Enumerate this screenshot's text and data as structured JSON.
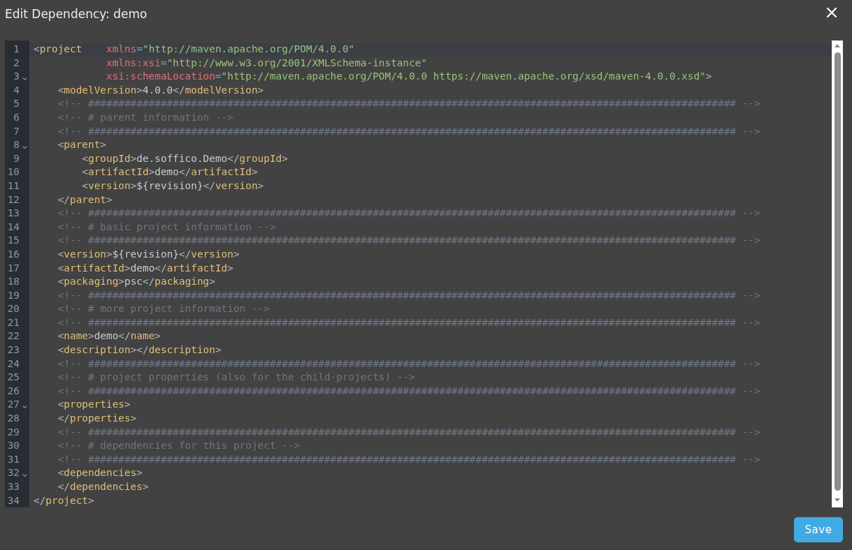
{
  "dialog": {
    "title": "Edit Dependency: demo"
  },
  "editor": {
    "lines": [
      {
        "number": "1",
        "current": true,
        "foldable": false,
        "tokens": [
          {
            "kind": "punct",
            "text": "<"
          },
          {
            "kind": "tag",
            "text": "project"
          },
          {
            "kind": "attr",
            "text": "    xmlns"
          },
          {
            "kind": "eq",
            "text": "="
          },
          {
            "kind": "value",
            "text": "\"http://maven.apache.org/POM/4.0.0\""
          }
        ]
      },
      {
        "number": "2",
        "current": false,
        "foldable": false,
        "tokens": [
          {
            "kind": "attr",
            "text": "            xmlns:xsi"
          },
          {
            "kind": "eq",
            "text": "="
          },
          {
            "kind": "value",
            "text": "\"http://www.w3.org/2001/XMLSchema-instance\""
          }
        ]
      },
      {
        "number": "3",
        "current": false,
        "foldable": true,
        "tokens": [
          {
            "kind": "attr",
            "text": "            xsi:schemaLocation"
          },
          {
            "kind": "eq",
            "text": "="
          },
          {
            "kind": "value",
            "text": "\"http://maven.apache.org/POM/4.0.0 https://maven.apache.org/xsd/maven-4.0.0.xsd\""
          },
          {
            "kind": "punct",
            "text": ">"
          }
        ]
      },
      {
        "number": "4",
        "current": false,
        "foldable": false,
        "tokens": [
          {
            "kind": "punct",
            "text": "    <"
          },
          {
            "kind": "tag",
            "text": "modelVersion"
          },
          {
            "kind": "punct",
            "text": ">"
          },
          {
            "kind": "text",
            "text": "4.0.0"
          },
          {
            "kind": "punct",
            "text": "</"
          },
          {
            "kind": "tag",
            "text": "modelVersion"
          },
          {
            "kind": "punct",
            "text": ">"
          }
        ]
      },
      {
        "number": "5",
        "current": false,
        "foldable": false,
        "tokens": [
          {
            "kind": "comment",
            "text": "    <!-- ########################################################################################################### -->"
          }
        ]
      },
      {
        "number": "6",
        "current": false,
        "foldable": false,
        "tokens": [
          {
            "kind": "comment",
            "text": "    <!-- # parent information -->"
          }
        ]
      },
      {
        "number": "7",
        "current": false,
        "foldable": false,
        "tokens": [
          {
            "kind": "comment",
            "text": "    <!-- ########################################################################################################### -->"
          }
        ]
      },
      {
        "number": "8",
        "current": false,
        "foldable": true,
        "tokens": [
          {
            "kind": "punct",
            "text": "    <"
          },
          {
            "kind": "tag",
            "text": "parent"
          },
          {
            "kind": "punct",
            "text": ">"
          }
        ]
      },
      {
        "number": "9",
        "current": false,
        "foldable": false,
        "tokens": [
          {
            "kind": "punct",
            "text": "        <"
          },
          {
            "kind": "tag",
            "text": "groupId"
          },
          {
            "kind": "punct",
            "text": ">"
          },
          {
            "kind": "text",
            "text": "de.soffico.Demo"
          },
          {
            "kind": "punct",
            "text": "</"
          },
          {
            "kind": "tag",
            "text": "groupId"
          },
          {
            "kind": "punct",
            "text": ">"
          }
        ]
      },
      {
        "number": "10",
        "current": false,
        "foldable": false,
        "tokens": [
          {
            "kind": "punct",
            "text": "        <"
          },
          {
            "kind": "tag",
            "text": "artifactId"
          },
          {
            "kind": "punct",
            "text": ">"
          },
          {
            "kind": "text",
            "text": "demo"
          },
          {
            "kind": "punct",
            "text": "</"
          },
          {
            "kind": "tag",
            "text": "artifactId"
          },
          {
            "kind": "punct",
            "text": ">"
          }
        ]
      },
      {
        "number": "11",
        "current": false,
        "foldable": false,
        "tokens": [
          {
            "kind": "punct",
            "text": "        <"
          },
          {
            "kind": "tag",
            "text": "version"
          },
          {
            "kind": "punct",
            "text": ">"
          },
          {
            "kind": "text",
            "text": "${revision}"
          },
          {
            "kind": "punct",
            "text": "</"
          },
          {
            "kind": "tag",
            "text": "version"
          },
          {
            "kind": "punct",
            "text": ">"
          }
        ]
      },
      {
        "number": "12",
        "current": false,
        "foldable": false,
        "tokens": [
          {
            "kind": "punct",
            "text": "    </"
          },
          {
            "kind": "tag",
            "text": "parent"
          },
          {
            "kind": "punct",
            "text": ">"
          }
        ]
      },
      {
        "number": "13",
        "current": false,
        "foldable": false,
        "tokens": [
          {
            "kind": "comment",
            "text": "    <!-- ########################################################################################################### -->"
          }
        ]
      },
      {
        "number": "14",
        "current": false,
        "foldable": false,
        "tokens": [
          {
            "kind": "comment",
            "text": "    <!-- # basic project information -->"
          }
        ]
      },
      {
        "number": "15",
        "current": false,
        "foldable": false,
        "tokens": [
          {
            "kind": "comment",
            "text": "    <!-- ########################################################################################################### -->"
          }
        ]
      },
      {
        "number": "16",
        "current": false,
        "foldable": false,
        "tokens": [
          {
            "kind": "punct",
            "text": "    <"
          },
          {
            "kind": "tag",
            "text": "version"
          },
          {
            "kind": "punct",
            "text": ">"
          },
          {
            "kind": "text",
            "text": "${revision}"
          },
          {
            "kind": "punct",
            "text": "</"
          },
          {
            "kind": "tag",
            "text": "version"
          },
          {
            "kind": "punct",
            "text": ">"
          }
        ]
      },
      {
        "number": "17",
        "current": false,
        "foldable": false,
        "tokens": [
          {
            "kind": "punct",
            "text": "    <"
          },
          {
            "kind": "tag",
            "text": "artifactId"
          },
          {
            "kind": "punct",
            "text": ">"
          },
          {
            "kind": "text",
            "text": "demo"
          },
          {
            "kind": "punct",
            "text": "</"
          },
          {
            "kind": "tag",
            "text": "artifactId"
          },
          {
            "kind": "punct",
            "text": ">"
          }
        ]
      },
      {
        "number": "18",
        "current": false,
        "foldable": false,
        "tokens": [
          {
            "kind": "punct",
            "text": "    <"
          },
          {
            "kind": "tag",
            "text": "packaging"
          },
          {
            "kind": "punct",
            "text": ">"
          },
          {
            "kind": "text",
            "text": "psc"
          },
          {
            "kind": "punct",
            "text": "</"
          },
          {
            "kind": "tag",
            "text": "packaging"
          },
          {
            "kind": "punct",
            "text": ">"
          }
        ]
      },
      {
        "number": "19",
        "current": false,
        "foldable": false,
        "tokens": [
          {
            "kind": "comment",
            "text": "    <!-- ########################################################################################################### -->"
          }
        ]
      },
      {
        "number": "20",
        "current": false,
        "foldable": false,
        "tokens": [
          {
            "kind": "comment",
            "text": "    <!-- # more project information -->"
          }
        ]
      },
      {
        "number": "21",
        "current": false,
        "foldable": false,
        "tokens": [
          {
            "kind": "comment",
            "text": "    <!-- ########################################################################################################### -->"
          }
        ]
      },
      {
        "number": "22",
        "current": false,
        "foldable": false,
        "tokens": [
          {
            "kind": "punct",
            "text": "    <"
          },
          {
            "kind": "tag",
            "text": "name"
          },
          {
            "kind": "punct",
            "text": ">"
          },
          {
            "kind": "text",
            "text": "demo"
          },
          {
            "kind": "punct",
            "text": "</"
          },
          {
            "kind": "tag",
            "text": "name"
          },
          {
            "kind": "punct",
            "text": ">"
          }
        ]
      },
      {
        "number": "23",
        "current": false,
        "foldable": false,
        "tokens": [
          {
            "kind": "punct",
            "text": "    <"
          },
          {
            "kind": "tag",
            "text": "description"
          },
          {
            "kind": "punct",
            "text": "></"
          },
          {
            "kind": "tag",
            "text": "description"
          },
          {
            "kind": "punct",
            "text": ">"
          }
        ]
      },
      {
        "number": "24",
        "current": false,
        "foldable": false,
        "tokens": [
          {
            "kind": "comment",
            "text": "    <!-- ########################################################################################################### -->"
          }
        ]
      },
      {
        "number": "25",
        "current": false,
        "foldable": false,
        "tokens": [
          {
            "kind": "comment",
            "text": "    <!-- # project properties (also for the child-projects) -->"
          }
        ]
      },
      {
        "number": "26",
        "current": false,
        "foldable": false,
        "tokens": [
          {
            "kind": "comment",
            "text": "    <!-- ########################################################################################################### -->"
          }
        ]
      },
      {
        "number": "27",
        "current": false,
        "foldable": true,
        "tokens": [
          {
            "kind": "punct",
            "text": "    <"
          },
          {
            "kind": "tag",
            "text": "properties"
          },
          {
            "kind": "punct",
            "text": ">"
          }
        ]
      },
      {
        "number": "28",
        "current": false,
        "foldable": false,
        "tokens": [
          {
            "kind": "punct",
            "text": "    </"
          },
          {
            "kind": "tag",
            "text": "properties"
          },
          {
            "kind": "punct",
            "text": ">"
          }
        ]
      },
      {
        "number": "29",
        "current": false,
        "foldable": false,
        "tokens": [
          {
            "kind": "comment",
            "text": "    <!-- ########################################################################################################### -->"
          }
        ]
      },
      {
        "number": "30",
        "current": false,
        "foldable": false,
        "tokens": [
          {
            "kind": "comment",
            "text": "    <!-- # dependencies for this project -->"
          }
        ]
      },
      {
        "number": "31",
        "current": false,
        "foldable": false,
        "tokens": [
          {
            "kind": "comment",
            "text": "    <!-- ########################################################################################################### -->"
          }
        ]
      },
      {
        "number": "32",
        "current": false,
        "foldable": true,
        "tokens": [
          {
            "kind": "punct",
            "text": "    <"
          },
          {
            "kind": "tag",
            "text": "dependencies"
          },
          {
            "kind": "punct",
            "text": ">"
          }
        ]
      },
      {
        "number": "33",
        "current": false,
        "foldable": false,
        "tokens": [
          {
            "kind": "punct",
            "text": "    </"
          },
          {
            "kind": "tag",
            "text": "dependencies"
          },
          {
            "kind": "punct",
            "text": ">"
          }
        ]
      },
      {
        "number": "34",
        "current": false,
        "foldable": false,
        "tokens": [
          {
            "kind": "punct",
            "text": "</"
          },
          {
            "kind": "tag",
            "text": "project"
          },
          {
            "kind": "punct",
            "text": ">"
          }
        ]
      }
    ]
  },
  "save_button": {
    "label": "Save"
  }
}
